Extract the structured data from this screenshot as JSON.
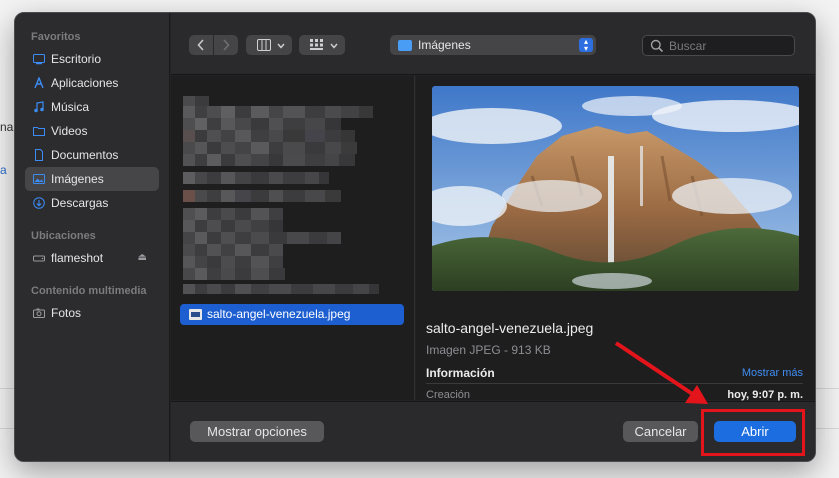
{
  "background": {
    "fragment_1": "na",
    "fragment_2": "a"
  },
  "sidebar": {
    "sections": [
      {
        "title": "Favoritos",
        "items": [
          {
            "label": "Escritorio",
            "icon": "desktop-icon"
          },
          {
            "label": "Aplicaciones",
            "icon": "applications-icon"
          },
          {
            "label": "Música",
            "icon": "music-icon"
          },
          {
            "label": "Videos",
            "icon": "videos-folder-icon"
          },
          {
            "label": "Documentos",
            "icon": "document-icon"
          },
          {
            "label": "Imágenes",
            "icon": "pictures-icon",
            "selected": true
          },
          {
            "label": "Descargas",
            "icon": "downloads-icon"
          }
        ]
      },
      {
        "title": "Ubicaciones",
        "items": [
          {
            "label": "flameshot",
            "icon": "drive-icon",
            "eject": true
          }
        ]
      },
      {
        "title": "Contenido multimedia",
        "items": [
          {
            "label": "Fotos",
            "icon": "camera-icon"
          }
        ]
      }
    ]
  },
  "toolbar": {
    "location": "Imágenes",
    "search_placeholder": "Buscar"
  },
  "files": {
    "selected": "salto-angel-venezuela.jpeg"
  },
  "preview": {
    "name": "salto-angel-venezuela.jpeg",
    "kind": "Imagen JPEG - 913 KB",
    "info_heading": "Información",
    "show_more": "Mostrar más",
    "created_label": "Creación",
    "created_value": "hoy, 9:07 p. m."
  },
  "buttons": {
    "options": "Mostrar opciones",
    "cancel": "Cancelar",
    "open": "Abrir"
  },
  "colors": {
    "accent": "#1c6de0",
    "annotation": "#e3151b"
  }
}
